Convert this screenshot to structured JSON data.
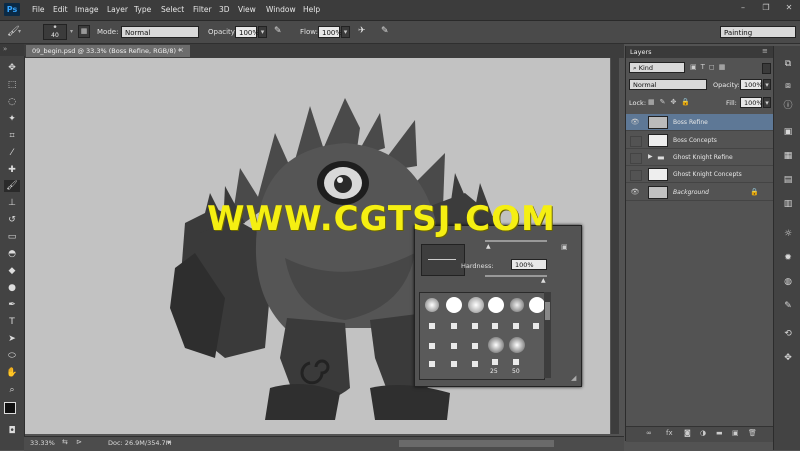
{
  "app": {
    "logo": "Ps"
  },
  "menu": [
    "File",
    "Edit",
    "Image",
    "Layer",
    "Type",
    "Select",
    "Filter",
    "3D",
    "View",
    "Window",
    "Help"
  ],
  "options": {
    "brush_size": "40",
    "mode_label": "Mode:",
    "mode_value": "Normal",
    "opacity_label": "Opacity:",
    "opacity_value": "100%",
    "flow_label": "Flow:",
    "flow_value": "100%",
    "workspace": "Painting"
  },
  "document": {
    "tab_title": "09_begin.psd @ 33.3% (Boss Refine, RGB/8) *"
  },
  "status": {
    "zoom": "33.33%",
    "doc_info": "Doc: 26.9M/354.7M"
  },
  "layers_panel": {
    "tab": "Layers",
    "kind": "Kind",
    "blend_mode": "Normal",
    "opacity_label": "Opacity:",
    "opacity_value": "100%",
    "lock_label": "Lock:",
    "fill_label": "Fill:",
    "fill_value": "100%",
    "layers": [
      {
        "name": "Boss Refine",
        "visible": true,
        "selected": true
      },
      {
        "name": "Boss Concepts",
        "visible": false,
        "selected": false
      },
      {
        "name": "Ghost Knight Refine",
        "visible": false,
        "selected": false,
        "is_group": true
      },
      {
        "name": "Ghost Knight Concepts",
        "visible": false,
        "selected": false
      },
      {
        "name": "Background",
        "visible": true,
        "selected": false,
        "locked": true
      }
    ]
  },
  "brush_picker": {
    "hardness_label": "Hardness:",
    "hardness_value": "100%",
    "size_labels": [
      "25",
      "50"
    ]
  },
  "watermark": "WWW.CGTSJ.COM",
  "colors": {
    "accent": "#36a6ff",
    "selected_layer": "#5e7896",
    "watermark": "#f5ef12"
  }
}
